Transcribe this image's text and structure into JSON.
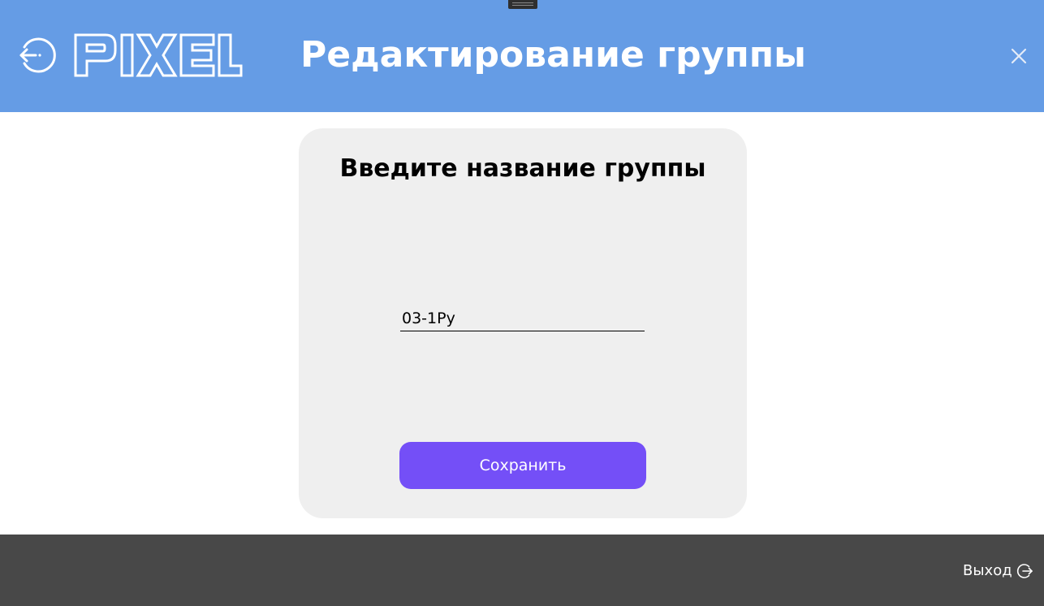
{
  "header": {
    "logo_text": "PIXEL",
    "title": "Редактирование группы",
    "back_icon": "back-arrow-circle-icon",
    "close_icon": "close-icon",
    "background_color": "#659ce5"
  },
  "card": {
    "title": "Введите название группы",
    "input_value": "03-1Ру",
    "save_label": "Сохранить",
    "button_color": "#744ff7",
    "background_color": "#efefef"
  },
  "footer": {
    "exit_label": "Выход",
    "exit_icon": "logout-circle-icon",
    "background_color": "#484848"
  }
}
